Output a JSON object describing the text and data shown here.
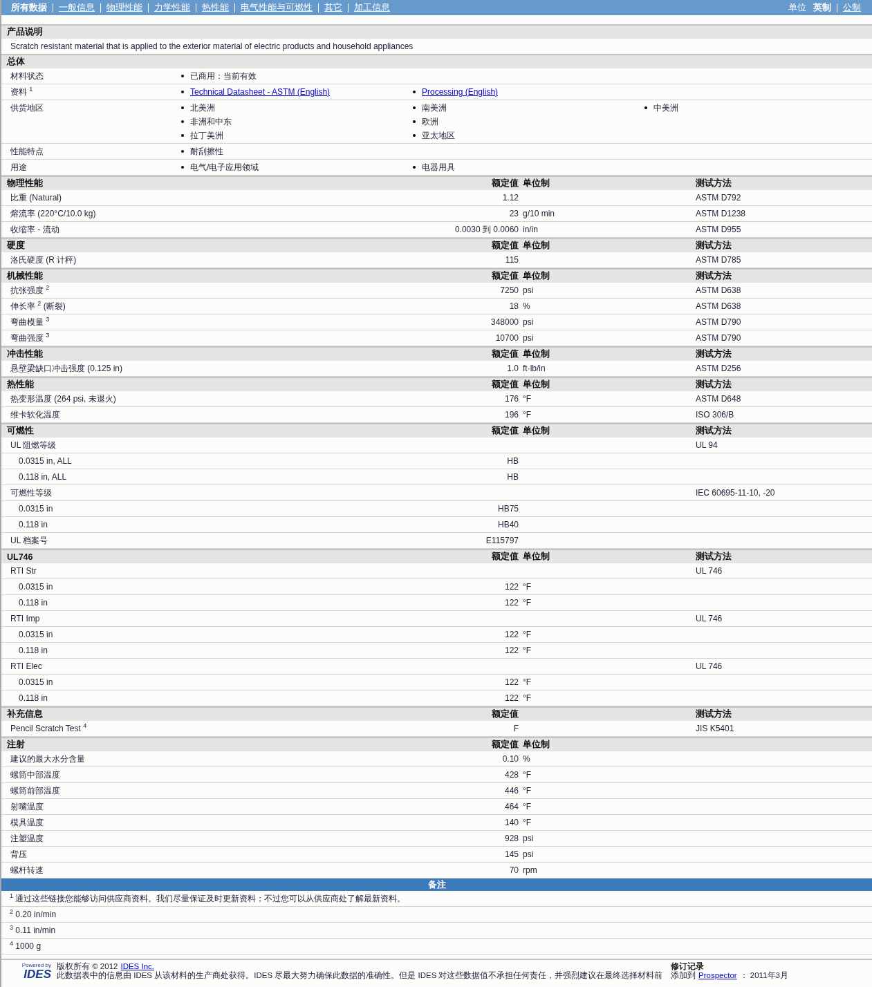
{
  "nav": {
    "items": [
      {
        "label": "所有数据",
        "selected": true
      },
      {
        "label": "一般信息",
        "selected": false
      },
      {
        "label": "物理性能",
        "selected": false
      },
      {
        "label": "力学性能",
        "selected": false
      },
      {
        "label": "热性能",
        "selected": false
      },
      {
        "label": "电气性能与可燃性",
        "selected": false
      },
      {
        "label": "其它",
        "selected": false
      },
      {
        "label": "加工信息",
        "selected": false
      }
    ],
    "units": {
      "label": "单位",
      "options": [
        {
          "label": "英制",
          "selected": true
        },
        {
          "label": "公制",
          "selected": false
        }
      ]
    }
  },
  "description": {
    "heading": "产品说明",
    "text": "Scratch resistant material that is applied to the exterior material of electric products and household appliances"
  },
  "general": {
    "heading": "总体",
    "rows": [
      {
        "label": "材料状态",
        "columns": [
          [
            {
              "text": "已商用：当前有效",
              "link": false
            }
          ]
        ]
      },
      {
        "label": "资料 $^{1}$",
        "columns": [
          [
            {
              "text": "Technical Datasheet - ASTM (English)",
              "link": true
            }
          ],
          [
            {
              "text": "Processing (English)",
              "link": true
            }
          ]
        ]
      },
      {
        "label": "供货地区",
        "columns": [
          [
            {
              "text": "北美洲",
              "link": false
            },
            {
              "text": "非洲和中东",
              "link": false
            },
            {
              "text": "拉丁美洲",
              "link": false
            }
          ],
          [
            {
              "text": "南美洲",
              "link": false
            },
            {
              "text": "欧洲",
              "link": false
            },
            {
              "text": "亚太地区",
              "link": false
            }
          ],
          [
            {
              "text": "中美洲",
              "link": false
            }
          ]
        ]
      },
      {
        "label": "性能特点",
        "columns": [
          [
            {
              "text": "耐刮擦性",
              "link": false
            }
          ]
        ]
      },
      {
        "label": "用途",
        "columns": [
          [
            {
              "text": "电气/电子应用领域",
              "link": false
            }
          ],
          [
            {
              "text": "电器用具",
              "link": false
            }
          ]
        ]
      }
    ]
  },
  "sections": [
    {
      "heading": "物理性能",
      "value_header": "额定值",
      "unit_header": "单位制",
      "method_header": "测试方法",
      "rows": [
        {
          "label": "比重  (Natural)",
          "value": "1.12",
          "method": "ASTM D792"
        },
        {
          "label": "熔流率  (220°C/10.0 kg)",
          "value": "23",
          "unit": "g/10 min",
          "method": "ASTM D1238"
        },
        {
          "label": "收缩率  - 流动",
          "value": "0.0030 到  0.0060",
          "unit": "in/in",
          "method": "ASTM D955"
        }
      ]
    },
    {
      "heading": "硬度",
      "value_header": "额定值",
      "unit_header": "单位制",
      "method_header": "测试方法",
      "rows": [
        {
          "label": "洛氏硬度  (R 计秤)",
          "value": "115",
          "method": "ASTM D785"
        }
      ]
    },
    {
      "heading": "机械性能",
      "value_header": "额定值",
      "unit_header": "单位制",
      "method_header": "测试方法",
      "rows": [
        {
          "label": "抗张强度 $^{2}$",
          "value": "7250",
          "unit": "psi",
          "method": "ASTM D638"
        },
        {
          "label": "伸长率 $^{2}$ (断裂)",
          "value": "18",
          "unit": "%",
          "method": "ASTM D638"
        },
        {
          "label": "弯曲模量 $^{3}$",
          "value": "348000",
          "unit": "psi",
          "method": "ASTM D790"
        },
        {
          "label": "弯曲强度 $^{3}$",
          "value": "10700",
          "unit": "psi",
          "method": "ASTM D790"
        }
      ]
    },
    {
      "heading": "冲击性能",
      "value_header": "额定值",
      "unit_header": "单位制",
      "method_header": "测试方法",
      "rows": [
        {
          "label": "悬壁梁缺口冲击强度  (0.125 in)",
          "value": "1.0",
          "unit": "ft·lb/in",
          "method": "ASTM D256"
        }
      ]
    },
    {
      "heading": "热性能",
      "value_header": "额定值",
      "unit_header": "单位制",
      "method_header": "测试方法",
      "rows": [
        {
          "label": "热变形温度  (264 psi, 未退火)",
          "value": "176",
          "unit": "°F",
          "method": "ASTM D648"
        },
        {
          "label": "维卡软化温度",
          "value": "196",
          "unit": "°F",
          "method": "ISO 306/B"
        }
      ]
    },
    {
      "heading": "可燃性",
      "value_header": "额定值",
      "unit_header": "单位制",
      "method_header": "测试方法",
      "rows": [
        {
          "label": "UL 阻燃等级",
          "method": "UL 94",
          "children": [
            {
              "label": "0.0315 in, ALL",
              "value": "HB"
            },
            {
              "label": "0.118 in, ALL",
              "value": "HB"
            }
          ]
        },
        {
          "label": "可燃性等级",
          "method": "IEC 60695-11-10, -20",
          "children": [
            {
              "label": "0.0315 in",
              "value": "HB75"
            },
            {
              "label": "0.118 in",
              "value": "HB40"
            }
          ]
        },
        {
          "label": "UL 档案号",
          "value": "E115797"
        }
      ]
    },
    {
      "heading": "UL746",
      "value_header": "额定值",
      "unit_header": "单位制",
      "method_header": "测试方法",
      "rows": [
        {
          "label": "RTI Str",
          "method": "UL 746",
          "children": [
            {
              "label": "0.0315 in",
              "value": "122",
              "unit": "°F"
            },
            {
              "label": "0.118 in",
              "value": "122",
              "unit": "°F"
            }
          ]
        },
        {
          "label": "RTI Imp",
          "method": "UL 746",
          "children": [
            {
              "label": "0.0315 in",
              "value": "122",
              "unit": "°F"
            },
            {
              "label": "0.118 in",
              "value": "122",
              "unit": "°F"
            }
          ]
        },
        {
          "label": "RTI Elec",
          "method": "UL 746",
          "children": [
            {
              "label": "0.0315 in",
              "value": "122",
              "unit": "°F"
            },
            {
              "label": "0.118 in",
              "value": "122",
              "unit": "°F"
            }
          ]
        }
      ]
    },
    {
      "heading": "补充信息",
      "value_header": "额定值",
      "method_header": "测试方法",
      "rows": [
        {
          "label": "Pencil Scratch Test $^{4}$",
          "value": "F",
          "method": "JIS K5401"
        }
      ]
    },
    {
      "heading": "注射",
      "value_header": "额定值",
      "unit_header": "单位制",
      "rows": [
        {
          "label": "建议的最大水分含量",
          "value": "0.10",
          "unit": "%"
        },
        {
          "label": "螺筒中部温度",
          "value": "428",
          "unit": "°F"
        },
        {
          "label": "螺筒前部温度",
          "value": "446",
          "unit": "°F"
        },
        {
          "label": "射嘴温度",
          "value": "464",
          "unit": "°F"
        },
        {
          "label": "模具温度",
          "value": "140",
          "unit": "°F"
        },
        {
          "label": "注塑温度",
          "value": "928",
          "unit": "psi"
        },
        {
          "label": "背压",
          "value": "145",
          "unit": "psi"
        },
        {
          "label": "螺杆转速",
          "value": "70",
          "unit": "rpm"
        }
      ]
    }
  ],
  "notes": {
    "heading": "备注",
    "items": [
      "$^{1}$ 通过这些链接您能够访问供应商资料。我们尽量保证及时更新资料；不过您可以从供应商处了解最新资料。",
      "$^{2}$ 0.20 in/min",
      "$^{3}$ 0.11 in/min",
      "$^{4}$ 1000 g"
    ]
  },
  "footer": {
    "logo": {
      "caption": "Powered by",
      "name": "IDES"
    },
    "copyright": "版权所有  © 2012",
    "company_link": "IDES Inc.",
    "disclaimer": "此数据表中的信息由 IDES 从该材料的生产商处获得。IDES 尽最大努力确保此数据的准确性。但是 IDES 对这些数据值不承担任何责任，并强烈建议在最终选择材料前",
    "revision": {
      "heading": "修订记录",
      "prefix": "添加到",
      "link": "Prospector",
      "date": "： 2011年3月"
    }
  }
}
